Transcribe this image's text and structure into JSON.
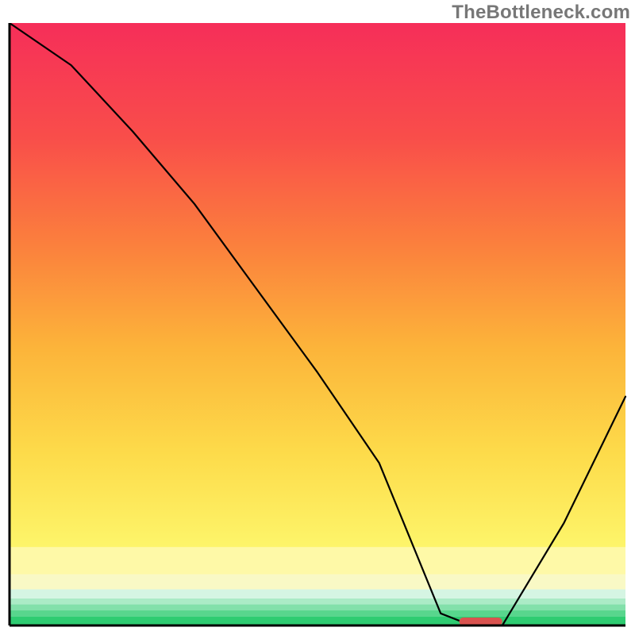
{
  "watermark": "TheBottleneck.com",
  "chart_data": {
    "type": "line",
    "title": "",
    "xlabel": "",
    "ylabel": "",
    "xlim": [
      0,
      100
    ],
    "ylim": [
      0,
      100
    ],
    "x": [
      0,
      10,
      20,
      30,
      40,
      50,
      60,
      66,
      70,
      75,
      80,
      90,
      100
    ],
    "values": [
      100,
      93,
      82,
      70,
      56,
      42,
      27,
      12,
      2,
      0,
      0,
      17,
      38
    ],
    "marker": {
      "x_start": 73,
      "x_end": 80,
      "y": 0
    },
    "background_bands": [
      {
        "y0": 0.0,
        "y1": 0.015,
        "color": "#2ecc71"
      },
      {
        "y0": 0.015,
        "y1": 0.025,
        "color": "#58d68d"
      },
      {
        "y0": 0.025,
        "y1": 0.035,
        "color": "#82e0aa"
      },
      {
        "y0": 0.035,
        "y1": 0.045,
        "color": "#abebc6"
      },
      {
        "y0": 0.045,
        "y1": 0.06,
        "color": "#d5f5e3"
      },
      {
        "y0": 0.06,
        "y1": 0.085,
        "color": "#f9f9c5"
      },
      {
        "y0": 0.085,
        "y1": 0.13,
        "color": "#fef9a7"
      },
      {
        "y0": 0.13,
        "y1": 1.0,
        "gradient": true
      }
    ],
    "axis_color": "#000000",
    "line_color": "#000000",
    "marker_color": "#d9534f"
  }
}
